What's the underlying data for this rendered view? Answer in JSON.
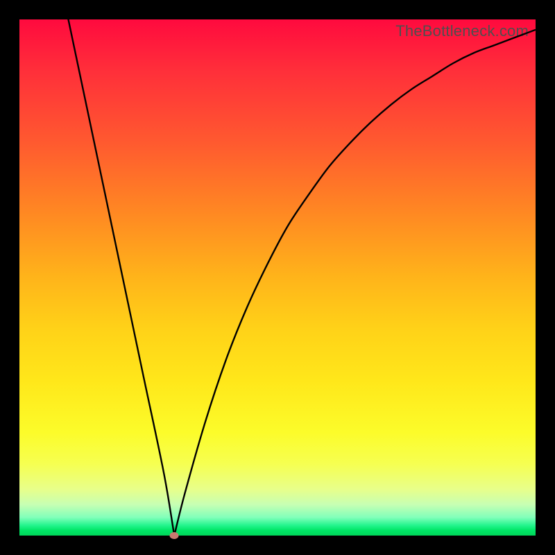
{
  "watermark": "TheBottleneck.com",
  "colors": {
    "frame": "#000000",
    "curve": "#000000",
    "dot": "#c97a6f"
  },
  "chart_data": {
    "type": "line",
    "title": "",
    "xlabel": "",
    "ylabel": "",
    "xlim": [
      0,
      100
    ],
    "ylim": [
      0,
      100
    ],
    "grid": false,
    "minimum": {
      "x": 30,
      "y": 0
    },
    "series": [
      {
        "name": "bottleneck-curve",
        "x": [
          0,
          4,
          8,
          12,
          16,
          20,
          24,
          28,
          30,
          32,
          36,
          40,
          44,
          48,
          52,
          56,
          60,
          64,
          68,
          72,
          76,
          80,
          84,
          88,
          92,
          96,
          100
        ],
        "y": [
          145,
          126,
          107,
          88,
          69,
          50,
          31,
          12,
          0,
          8,
          22,
          34,
          44,
          52.5,
          60,
          66,
          71.5,
          76,
          80,
          83.5,
          86.5,
          89,
          91.5,
          93.5,
          95,
          96.5,
          98
        ]
      }
    ],
    "note": "Curve is a V-shaped bottleneck percentage plot over a rainbow gradient background. y-values estimated from pixel heights; values above 100 indicate the left branch starts above the plot frame."
  }
}
